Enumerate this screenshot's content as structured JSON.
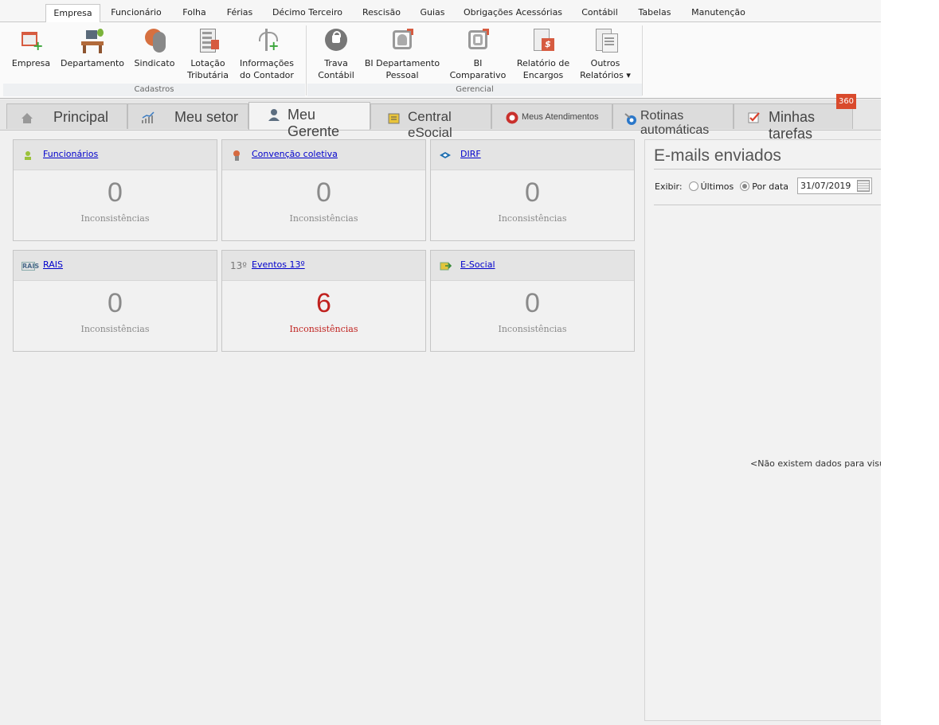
{
  "ribbon": {
    "tabs": [
      "Empresa",
      "Funcionário",
      "Folha",
      "Férias",
      "Décimo Terceiro",
      "Rescisão",
      "Guias",
      "Obrigações Acessórias",
      "Contábil",
      "Tabelas",
      "Manutenção"
    ],
    "active_tab": "Empresa",
    "groups": [
      {
        "label": "Cadastros",
        "buttons": [
          {
            "line1": "Empresa",
            "line2": ""
          },
          {
            "line1": "Departamento",
            "line2": ""
          },
          {
            "line1": "Sindicato",
            "line2": ""
          },
          {
            "line1": "Lotação",
            "line2": "Tributária"
          },
          {
            "line1": "Informações",
            "line2": "do Contador"
          }
        ]
      },
      {
        "label": "Gerencial",
        "buttons": [
          {
            "line1": "Trava",
            "line2": "Contábil"
          },
          {
            "line1": "BI Departamento",
            "line2": "Pessoal"
          },
          {
            "line1": "BI",
            "line2": "Comparativo"
          },
          {
            "line1": "Relatório de",
            "line2": "Encargos"
          },
          {
            "line1": "Outros",
            "line2": "Relatórios ▾"
          }
        ]
      }
    ]
  },
  "main_tabs": [
    {
      "label": "Principal",
      "icon": "home-icon"
    },
    {
      "label": "Meu setor",
      "icon": "chart-icon"
    },
    {
      "label": "Meu Gerente",
      "icon": "user-icon",
      "active": true
    },
    {
      "label": "Central eSocial",
      "icon": "document-icon"
    },
    {
      "label": "Meus Atendimentos",
      "icon": "support-icon"
    },
    {
      "label": "Rotinas automáticas",
      "icon": "routine-icon"
    },
    {
      "label": "Minhas tarefas",
      "icon": "checkbox-icon"
    }
  ],
  "tasks_badge": "360",
  "cards": [
    {
      "title": "Funcionários",
      "count": "0",
      "label": "Inconsistências",
      "icon": "employee-icon"
    },
    {
      "title": "Convenção coletiva",
      "count": "0",
      "label": "Inconsistências",
      "icon": "union-icon"
    },
    {
      "title": "DIRF",
      "count": "0",
      "label": "Inconsistências",
      "icon": "dirf-icon"
    },
    {
      "title": "RAIS",
      "count": "0",
      "label": "Inconsistências",
      "icon": "rais-icon",
      "icon_text": "RAIS"
    },
    {
      "title": "Eventos 13º",
      "count": "6",
      "label": "Inconsistências",
      "icon": "thirteenth-icon",
      "icon_text": "13º",
      "alert": true
    },
    {
      "title": "E-Social",
      "count": "0",
      "label": "Inconsistências",
      "icon": "esocial-icon"
    }
  ],
  "emails": {
    "title": "E-mails enviados",
    "show_label": "Exibir:",
    "option_last": "Últimos",
    "option_date": "Por data",
    "selected_option": "Por data",
    "date": "31/07/2019",
    "empty_message": "<Não existem dados para visual"
  },
  "colors": {
    "alert": "#c0221f",
    "badge": "#d94a2c",
    "link": "#0000cc"
  }
}
